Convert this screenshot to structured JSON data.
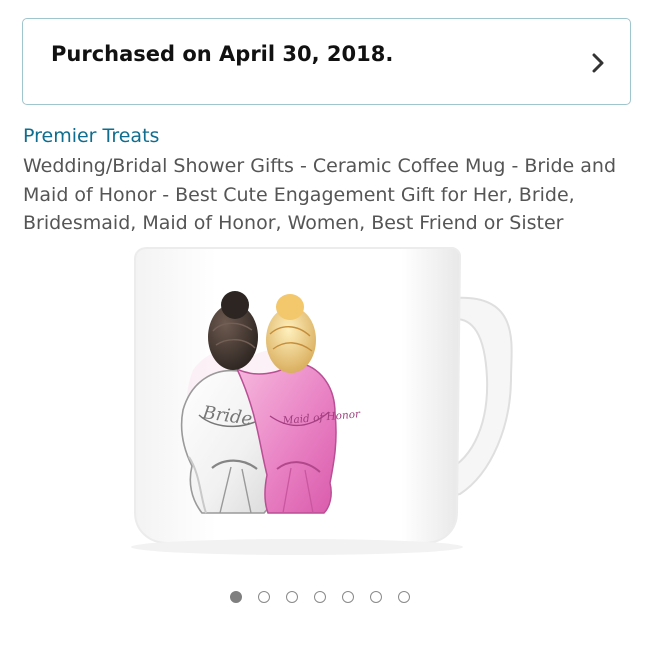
{
  "purchase_banner": {
    "text": "Purchased on April 30, 2018.",
    "chevron_icon": "chevron-right-icon"
  },
  "product": {
    "brand": "Premier Treats",
    "title": "Wedding/Bridal Shower Gifts - Ceramic Coffee Mug - Bride and Maid of Honor - Best Cute Engagement Gift for Her, Bride, Bridesmaid, Maid of Honor, Women, Best Friend or Sister",
    "image": {
      "left_robe_text": "Bride",
      "right_robe_text": "Maid of Honor"
    }
  },
  "image_carousel": {
    "total_images": 7,
    "active_index": 0
  },
  "colors": {
    "brand_link": "#0f6e8f",
    "banner_border": "#9fc5cf",
    "secondary_text": "#555555",
    "active_dot": "#7f7f7f"
  }
}
